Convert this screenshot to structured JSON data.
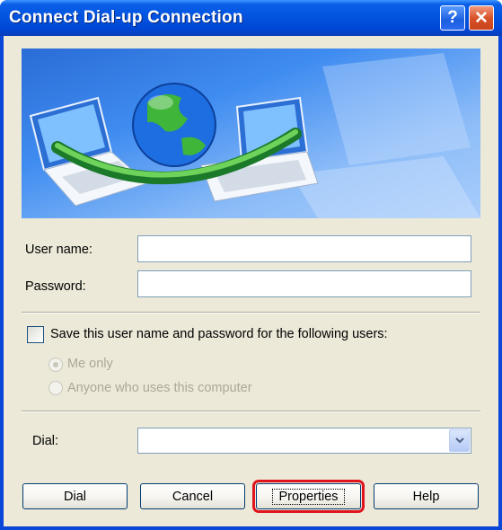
{
  "window": {
    "title": "Connect Dial-up Connection"
  },
  "titlebar": {
    "help_label": "?",
    "close_label": "✕"
  },
  "form": {
    "username_label": "User name:",
    "username_value": "",
    "password_label": "Password:",
    "password_value": ""
  },
  "save": {
    "checkbox_label": "Save this user name and password for the following users:",
    "checked": false,
    "options": [
      {
        "label": "Me only",
        "selected": true,
        "enabled": false
      },
      {
        "label": "Anyone who uses this computer",
        "selected": false,
        "enabled": false
      }
    ]
  },
  "dial": {
    "label": "Dial:",
    "value": ""
  },
  "buttons": {
    "dial": "Dial",
    "cancel": "Cancel",
    "properties": "Properties",
    "help": "Help"
  },
  "colors": {
    "highlight": "#e0141c",
    "titlebar": "#0a46d8"
  },
  "icons": [
    "help-icon",
    "close-icon",
    "chevron-down-icon"
  ]
}
